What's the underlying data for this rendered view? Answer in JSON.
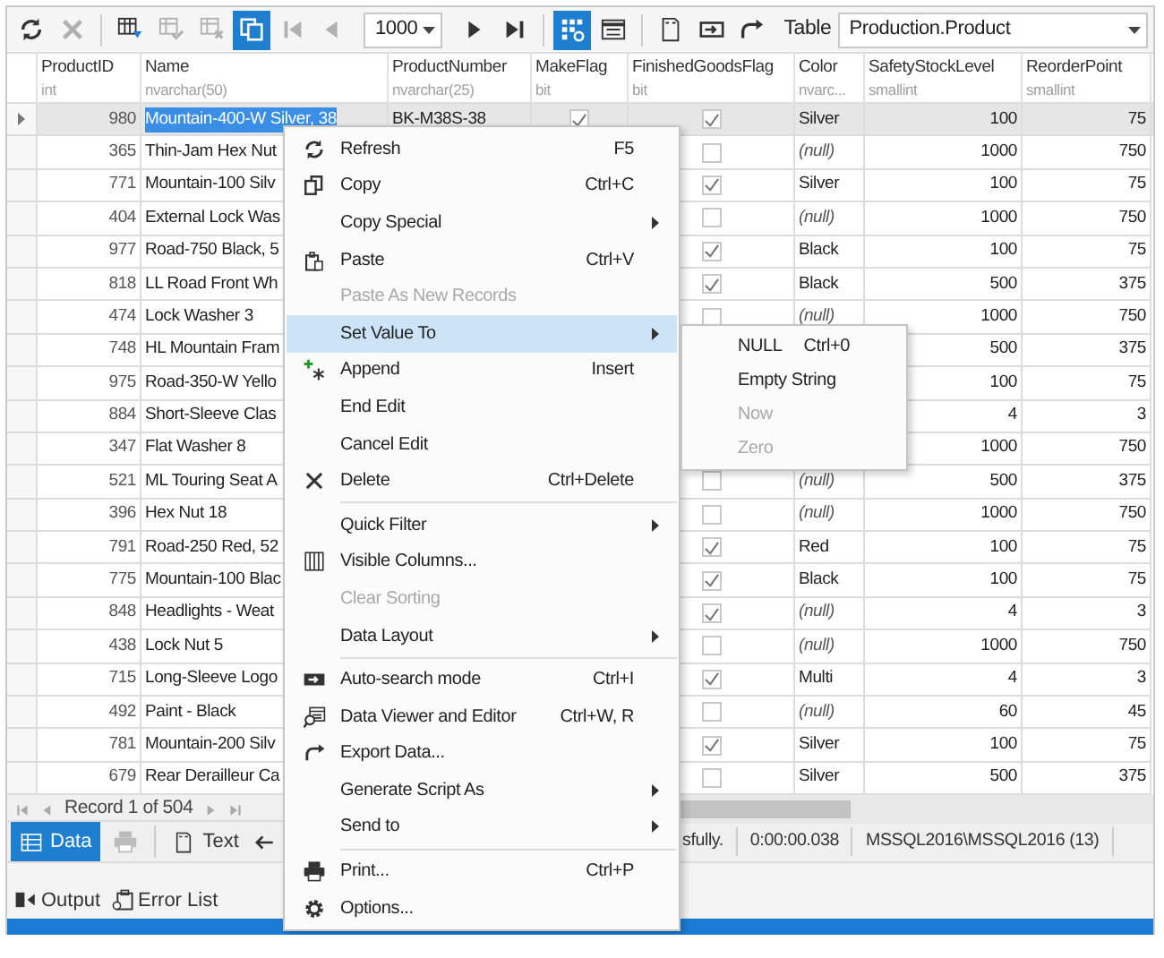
{
  "toolbar": [
    {
      "kind": "refresh",
      "disabled": false,
      "selected": false
    },
    {
      "kind": "cancel",
      "disabled": true,
      "selected": false
    },
    {
      "kind": "separator"
    },
    {
      "kind": "grid-down",
      "disabled": false,
      "selected": false
    },
    {
      "kind": "grid-check",
      "disabled": true,
      "selected": false
    },
    {
      "kind": "grid-x",
      "disabled": true,
      "selected": false
    },
    {
      "kind": "copy-pages",
      "disabled": false,
      "selected": true
    },
    {
      "kind": "first",
      "disabled": true,
      "selected": false
    },
    {
      "kind": "prev",
      "disabled": true,
      "selected": false
    },
    {
      "kind": "combo",
      "value": "1000"
    },
    {
      "kind": "next",
      "disabled": false,
      "selected": false
    },
    {
      "kind": "last",
      "disabled": false,
      "selected": false
    },
    {
      "kind": "separator"
    },
    {
      "kind": "grid-dots",
      "disabled": false,
      "selected": true
    },
    {
      "kind": "form",
      "disabled": false,
      "selected": false
    },
    {
      "kind": "separator"
    },
    {
      "kind": "doc",
      "disabled": false,
      "selected": false
    },
    {
      "kind": "arrow-box",
      "disabled": false,
      "selected": false
    },
    {
      "kind": "redo",
      "disabled": false,
      "selected": false
    },
    {
      "kind": "label",
      "text": "Table"
    },
    {
      "kind": "table-combo",
      "value": "Production.Product"
    }
  ],
  "columns": [
    {
      "name": "ProductID",
      "type": "int"
    },
    {
      "name": "Name",
      "type": "nvarchar(50)"
    },
    {
      "name": "ProductNumber",
      "type": "nvarchar(25)"
    },
    {
      "name": "MakeFlag",
      "type": "bit"
    },
    {
      "name": "FinishedGoodsFlag",
      "type": "bit"
    },
    {
      "name": "Color",
      "type": "nvarc..."
    },
    {
      "name": "SafetyStockLevel",
      "type": "smallint"
    },
    {
      "name": "ReorderPoint",
      "type": "smallint"
    }
  ],
  "rows": [
    {
      "selected": true,
      "id": "980",
      "name": "Mountain-400-W Silver, 38",
      "number": "BK-M38S-38",
      "make_flag": true,
      "finished": true,
      "color_name": "Silver",
      "color_null": false,
      "safety": "100",
      "reorder": "75"
    },
    {
      "selected": false,
      "id": "365",
      "name": "Thin-Jam Hex Nut",
      "finished": false,
      "color_name": "(null)",
      "color_null": true,
      "safety": "1000",
      "reorder": "750"
    },
    {
      "selected": false,
      "id": "771",
      "name": "Mountain-100 Silv",
      "finished": true,
      "color_name": "Silver",
      "color_null": false,
      "safety": "100",
      "reorder": "75"
    },
    {
      "selected": false,
      "id": "404",
      "name": "External Lock Was",
      "finished": false,
      "color_name": "(null)",
      "color_null": true,
      "safety": "1000",
      "reorder": "750"
    },
    {
      "selected": false,
      "id": "977",
      "name": "Road-750 Black, 5",
      "finished": true,
      "color_name": "Black",
      "color_null": false,
      "safety": "100",
      "reorder": "75"
    },
    {
      "selected": false,
      "id": "818",
      "name": "LL Road Front Wh",
      "finished": true,
      "color_name": "Black",
      "color_null": false,
      "safety": "500",
      "reorder": "375"
    },
    {
      "selected": false,
      "id": "474",
      "name": "Lock Washer 3",
      "finished": false,
      "color_name": "(null)",
      "color_null": true,
      "safety": "1000",
      "reorder": "750"
    },
    {
      "selected": false,
      "id": "748",
      "name": "HL Mountain Fram",
      "safety": "500",
      "reorder": "375"
    },
    {
      "selected": false,
      "id": "975",
      "name": "Road-350-W Yello",
      "safety": "100",
      "reorder": "75"
    },
    {
      "selected": false,
      "id": "884",
      "name": "Short-Sleeve Clas",
      "safety": "4",
      "reorder": "3"
    },
    {
      "selected": false,
      "id": "347",
      "name": "Flat Washer 8",
      "safety": "1000",
      "reorder": "750"
    },
    {
      "selected": false,
      "id": "521",
      "name": "ML Touring Seat A",
      "finished": false,
      "color_name": "(null)",
      "color_null": true,
      "safety": "500",
      "reorder": "375"
    },
    {
      "selected": false,
      "id": "396",
      "name": "Hex Nut 18",
      "finished": false,
      "color_name": "(null)",
      "color_null": true,
      "safety": "1000",
      "reorder": "750"
    },
    {
      "selected": false,
      "id": "791",
      "name": "Road-250 Red, 52",
      "finished": true,
      "color_name": "Red",
      "color_null": false,
      "safety": "100",
      "reorder": "75"
    },
    {
      "selected": false,
      "id": "775",
      "name": "Mountain-100 Blac",
      "finished": true,
      "color_name": "Black",
      "color_null": false,
      "safety": "100",
      "reorder": "75"
    },
    {
      "selected": false,
      "id": "848",
      "name": "Headlights - Weat",
      "finished": true,
      "color_name": "(null)",
      "color_null": true,
      "safety": "4",
      "reorder": "3"
    },
    {
      "selected": false,
      "id": "438",
      "name": "Lock Nut 5",
      "finished": false,
      "color_name": "(null)",
      "color_null": true,
      "safety": "1000",
      "reorder": "750"
    },
    {
      "selected": false,
      "id": "715",
      "name": "Long-Sleeve Logo",
      "finished": true,
      "color_name": "Multi",
      "color_null": false,
      "safety": "4",
      "reorder": "3"
    },
    {
      "selected": false,
      "id": "492",
      "name": "Paint - Black",
      "finished": false,
      "color_name": "(null)",
      "color_null": true,
      "safety": "60",
      "reorder": "45"
    },
    {
      "selected": false,
      "id": "781",
      "name": "Mountain-200 Silv",
      "finished": true,
      "color_name": "Silver",
      "color_null": false,
      "safety": "100",
      "reorder": "75"
    },
    {
      "selected": false,
      "id": "679",
      "name": "Rear Derailleur Ca",
      "finished": false,
      "color_name": "Silver",
      "color_null": false,
      "safety": "500",
      "reorder": "375"
    }
  ],
  "navigator": {
    "record": "Record 1 of 504"
  },
  "result_tabs": [
    {
      "kind": "data",
      "label": "Data",
      "selected": true
    },
    {
      "kind": "print",
      "disabled": true
    },
    {
      "kind": "text",
      "label": "Text",
      "selected": false
    },
    {
      "kind": "back-arrow"
    }
  ],
  "status": [
    "sfully.",
    "0:00:00.038",
    "MSSQL2016\\MSSQL2016 (13)"
  ],
  "panel_tabs": [
    {
      "kind": "output",
      "label": "Output"
    },
    {
      "kind": "errors",
      "label": "Error List"
    }
  ],
  "context_menu": [
    {
      "kind": "refresh",
      "label": "Refresh",
      "shortcut": "F5",
      "disabled": false,
      "has_submenu": false,
      "selected": false
    },
    {
      "kind": "copy",
      "label": "Copy",
      "shortcut": "Ctrl+C",
      "disabled": false,
      "has_submenu": false,
      "selected": false
    },
    {
      "kind": "item",
      "label": "Copy Special",
      "disabled": false,
      "has_submenu": true,
      "selected": false
    },
    {
      "kind": "paste",
      "label": "Paste",
      "shortcut": "Ctrl+V",
      "disabled": false,
      "has_submenu": false,
      "selected": false
    },
    {
      "kind": "item",
      "label": "Paste As New Records",
      "disabled": true,
      "has_submenu": false,
      "selected": false
    },
    {
      "kind": "item",
      "label": "Set Value To",
      "disabled": false,
      "has_submenu": true,
      "selected": true,
      "open_submenu": [
        {
          "label": "NULL",
          "shortcut": "Ctrl+0",
          "disabled": false
        },
        {
          "label": "Empty String",
          "disabled": false
        },
        {
          "label": "Now",
          "disabled": true
        },
        {
          "label": "Zero",
          "disabled": true
        }
      ]
    },
    {
      "kind": "append",
      "label": "Append",
      "shortcut": "Insert",
      "disabled": false,
      "has_submenu": false,
      "selected": false
    },
    {
      "kind": "item",
      "label": "End Edit",
      "disabled": false,
      "has_submenu": false,
      "selected": false
    },
    {
      "kind": "item",
      "label": "Cancel Edit",
      "disabled": false,
      "has_submenu": false,
      "selected": false
    },
    {
      "kind": "delete",
      "label": "Delete",
      "shortcut": "Ctrl+Delete",
      "disabled": false,
      "has_submenu": false,
      "selected": false
    },
    {
      "kind": "separator"
    },
    {
      "kind": "item",
      "label": "Quick Filter",
      "disabled": false,
      "has_submenu": true,
      "selected": false
    },
    {
      "kind": "columns",
      "label": "Visible Columns...",
      "disabled": false,
      "has_submenu": false,
      "selected": false
    },
    {
      "kind": "item",
      "label": "Clear Sorting",
      "disabled": true,
      "has_submenu": false,
      "selected": false
    },
    {
      "kind": "item",
      "label": "Data Layout",
      "disabled": false,
      "has_submenu": true,
      "selected": false
    },
    {
      "kind": "separator"
    },
    {
      "kind": "autosearch",
      "label": "Auto-search mode",
      "shortcut": "Ctrl+I",
      "disabled": false,
      "has_submenu": false,
      "selected": false
    },
    {
      "kind": "viewer",
      "label": "Data Viewer and Editor",
      "shortcut": "Ctrl+W, R",
      "disabled": false,
      "has_submenu": false,
      "selected": false
    },
    {
      "kind": "export",
      "label": "Export Data...",
      "disabled": false,
      "has_submenu": false,
      "selected": false
    },
    {
      "kind": "item",
      "label": "Generate Script As",
      "disabled": false,
      "has_submenu": true,
      "selected": false
    },
    {
      "kind": "item",
      "label": "Send to",
      "disabled": false,
      "has_submenu": true,
      "selected": false
    },
    {
      "kind": "separator"
    },
    {
      "kind": "print",
      "label": "Print...",
      "shortcut": "Ctrl+P",
      "disabled": false,
      "has_submenu": false,
      "selected": false
    },
    {
      "kind": "gear",
      "label": "Options...",
      "disabled": false,
      "has_submenu": false,
      "selected": false
    }
  ]
}
